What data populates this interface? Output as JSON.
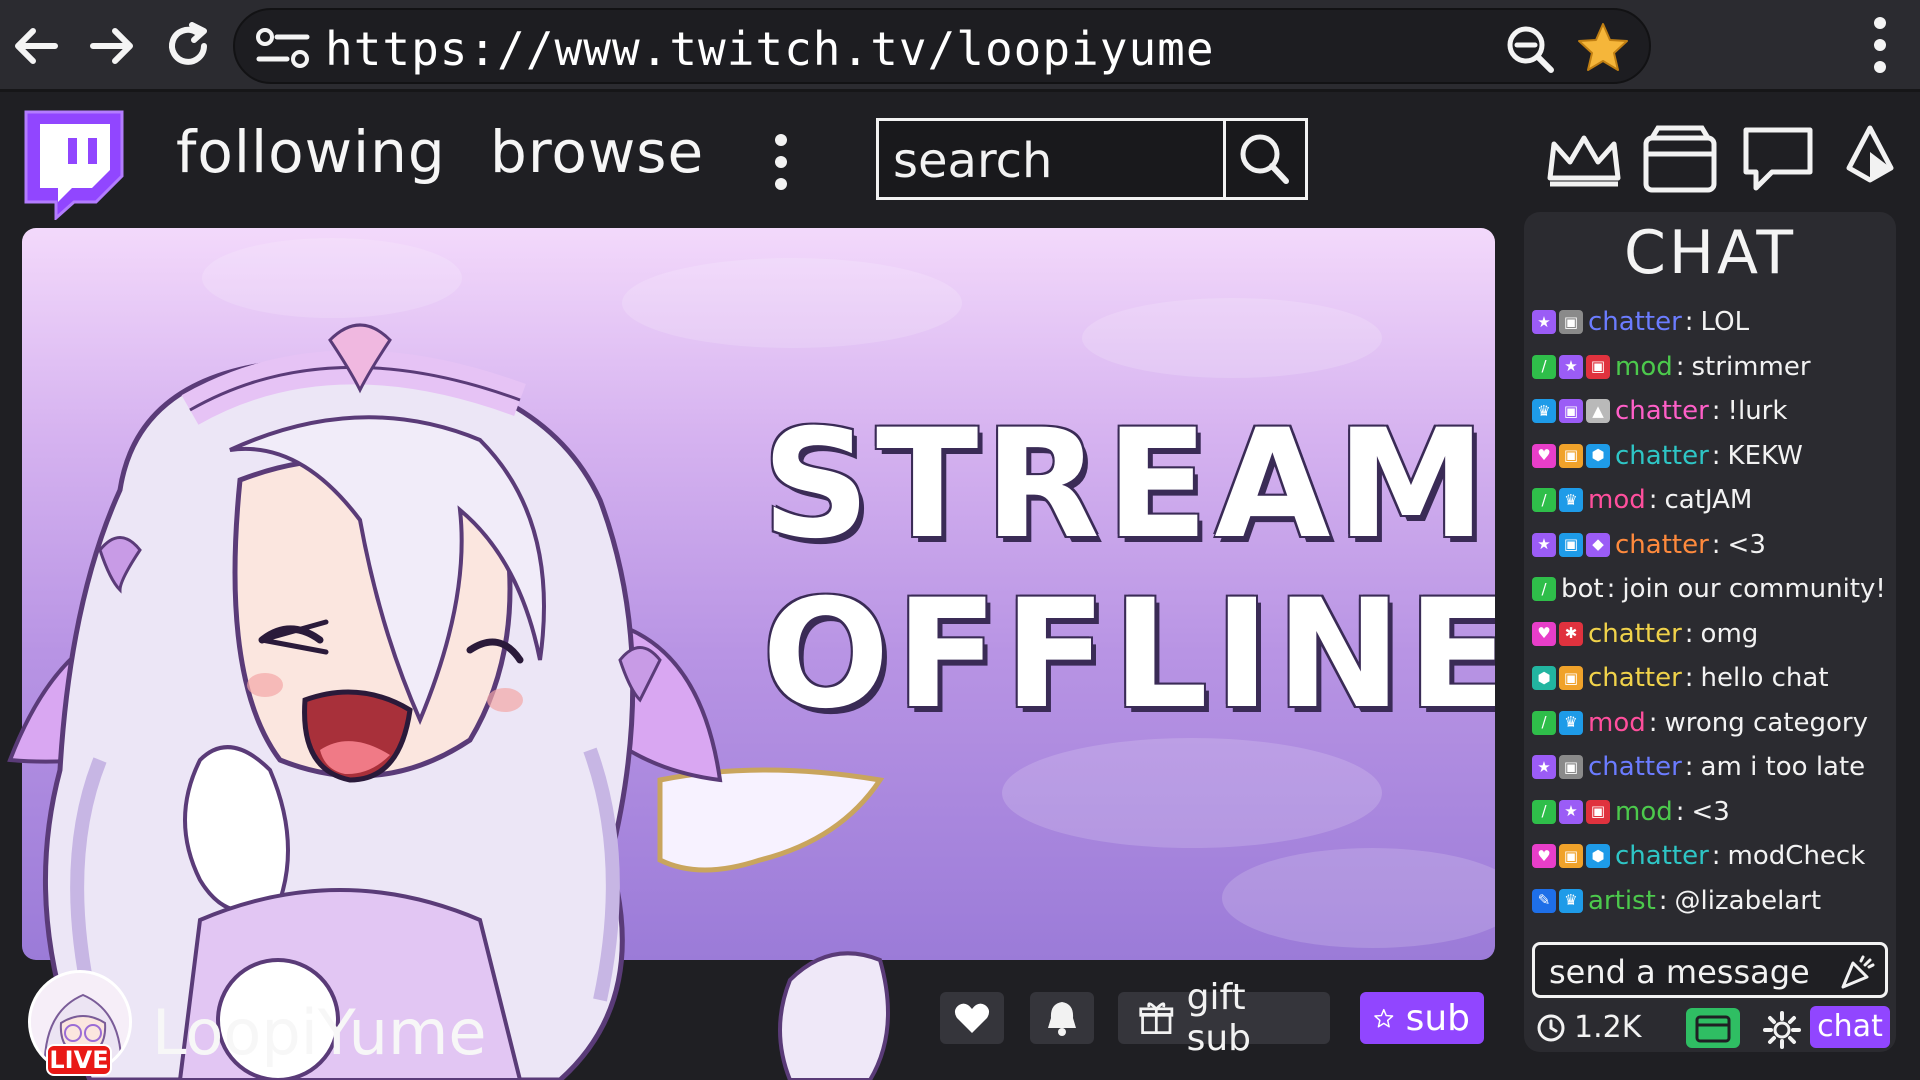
{
  "browser": {
    "url": "https://www.twitch.tv/loopiyume",
    "icons": [
      "back-arrow-icon",
      "forward-arrow-icon",
      "reload-icon",
      "site-settings-icon",
      "zoom-out-icon",
      "bookmark-star-icon",
      "menu-kebab-icon"
    ]
  },
  "header": {
    "following_label": "following",
    "browse_label": "browse",
    "search_placeholder": "search",
    "icons": [
      "twitch-logo-icon",
      "crown-icon",
      "inbox-icon",
      "whispers-icon",
      "bits-icon"
    ]
  },
  "player": {
    "offline_line1": "STREAM",
    "offline_line2": "OFFLINE"
  },
  "channel": {
    "name": "LoopiYume",
    "live_badge": "LIVE",
    "gift_sub_label": "gift sub",
    "sub_label": "sub"
  },
  "chat": {
    "title": "CHAT",
    "messages": [
      {
        "badges": [
          {
            "color": "#9b5cf6",
            "glyph": "★"
          },
          {
            "color": "#8a8a8a",
            "glyph": "▣"
          }
        ],
        "user": "chatter",
        "user_color": "#6b7cff",
        "text": "LOL"
      },
      {
        "badges": [
          {
            "color": "#2fbe4a",
            "glyph": "/"
          },
          {
            "color": "#9b5cf6",
            "glyph": "★"
          },
          {
            "color": "#e0323e",
            "glyph": "▣"
          }
        ],
        "user": "mod",
        "user_color": "#4cc94c",
        "text": "strimmer"
      },
      {
        "badges": [
          {
            "color": "#1e9be8",
            "glyph": "♛"
          },
          {
            "color": "#9b5cf6",
            "glyph": "▣"
          },
          {
            "color": "#b9b9b9",
            "glyph": "▲"
          }
        ],
        "user": "chatter",
        "user_color": "#ff5fc8",
        "text": "!lurk"
      },
      {
        "badges": [
          {
            "color": "#e83ec9",
            "glyph": "♥"
          },
          {
            "color": "#f0a22a",
            "glyph": "▣"
          },
          {
            "color": "#1e9be8",
            "glyph": "⬢"
          }
        ],
        "user": "chatter",
        "user_color": "#2ec6c6",
        "text": "KEKW"
      },
      {
        "badges": [
          {
            "color": "#2fbe4a",
            "glyph": "/"
          },
          {
            "color": "#1e9be8",
            "glyph": "♛"
          }
        ],
        "user": "mod",
        "user_color": "#ff4f9d",
        "text": "catJAM"
      },
      {
        "badges": [
          {
            "color": "#9b5cf6",
            "glyph": "★"
          },
          {
            "color": "#1e9be8",
            "glyph": "▣"
          },
          {
            "color": "#9b5cf6",
            "glyph": "◆"
          }
        ],
        "user": "chatter",
        "user_color": "#ff8a3d",
        "text": "<3"
      },
      {
        "badges": [
          {
            "color": "#2fbe4a",
            "glyph": "/"
          }
        ],
        "user": "bot",
        "user_color": "#f2f2f2",
        "text": "join our community!"
      },
      {
        "badges": [
          {
            "color": "#e83ec9",
            "glyph": "♥"
          },
          {
            "color": "#e0323e",
            "glyph": "✱"
          }
        ],
        "user": "chatter",
        "user_color": "#f0d24a",
        "text": "omg"
      },
      {
        "badges": [
          {
            "color": "#22b5a0",
            "glyph": "⬢"
          },
          {
            "color": "#f0a22a",
            "glyph": "▣"
          }
        ],
        "user": "chatter",
        "user_color": "#f0d24a",
        "text": "hello chat"
      },
      {
        "badges": [
          {
            "color": "#2fbe4a",
            "glyph": "/"
          },
          {
            "color": "#1e9be8",
            "glyph": "♛"
          }
        ],
        "user": "mod",
        "user_color": "#ff4f9d",
        "text": "wrong category"
      },
      {
        "badges": [
          {
            "color": "#9b5cf6",
            "glyph": "★"
          },
          {
            "color": "#8a8a8a",
            "glyph": "▣"
          }
        ],
        "user": "chatter",
        "user_color": "#6b7cff",
        "text": "am i too late"
      },
      {
        "badges": [
          {
            "color": "#2fbe4a",
            "glyph": "/"
          },
          {
            "color": "#9b5cf6",
            "glyph": "★"
          },
          {
            "color": "#e0323e",
            "glyph": "▣"
          }
        ],
        "user": "mod",
        "user_color": "#4cc94c",
        "text": "<3"
      },
      {
        "badges": [
          {
            "color": "#e83ec9",
            "glyph": "♥"
          },
          {
            "color": "#f0a22a",
            "glyph": "▣"
          },
          {
            "color": "#1e9be8",
            "glyph": "⬢"
          }
        ],
        "user": "chatter",
        "user_color": "#2ec6c6",
        "text": "modCheck"
      },
      {
        "badges": [
          {
            "color": "#1e6fe8",
            "glyph": "✎"
          },
          {
            "color": "#1e9be8",
            "glyph": "♛"
          }
        ],
        "user": "artist",
        "user_color": "#4cc94c",
        "text": "@lizabelart"
      }
    ],
    "input_placeholder": "send a message",
    "viewer_count": "1.2K",
    "chat_button_label": "chat"
  },
  "colors": {
    "background": "#1f1f23",
    "panel": "#2b2b30",
    "twitch_purple": "#9146ff",
    "live_red": "#e91916",
    "points_green": "#2fbe63"
  }
}
